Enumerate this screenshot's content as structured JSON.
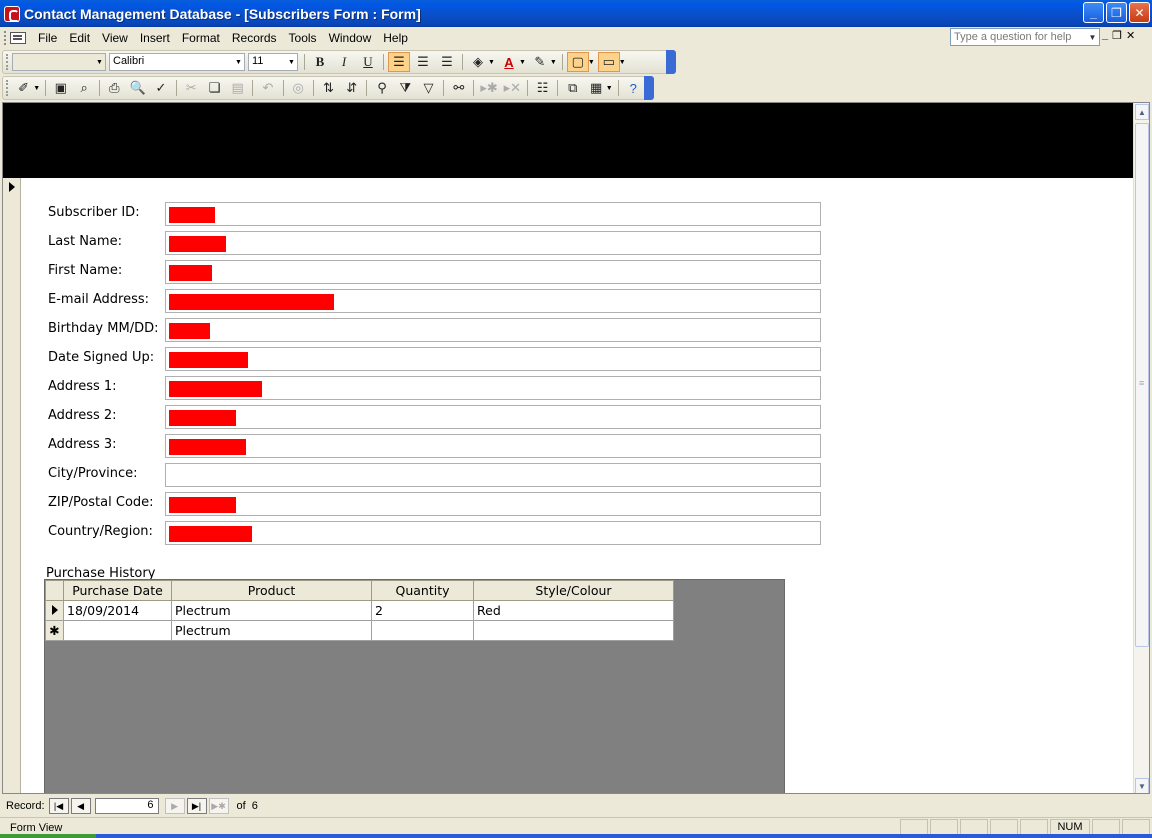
{
  "window": {
    "title": "Contact Management Database - [Subscribers Form : Form]",
    "minimize": "_",
    "restore": "❐",
    "close": "✕"
  },
  "menu": {
    "items": [
      "File",
      "Edit",
      "View",
      "Insert",
      "Format",
      "Records",
      "Tools",
      "Window",
      "Help"
    ],
    "help_placeholder": "Type a question for help",
    "mdi_min": "_",
    "mdi_restore": "❐",
    "mdi_close": "✕"
  },
  "toolbar": {
    "object_combo": "",
    "font_name": "Calibri",
    "font_size": "11",
    "bold": "B",
    "italic": "I",
    "underline": "U"
  },
  "form": {
    "fields": [
      {
        "label": "Subscriber ID:",
        "value": "",
        "redacted": true
      },
      {
        "label": "Last Name:",
        "value": "",
        "redacted": true
      },
      {
        "label": "First Name:",
        "value": "",
        "redacted": true
      },
      {
        "label": "E-mail Address:",
        "value": "",
        "redacted": true
      },
      {
        "label": "Birthday MM/DD:",
        "value": "",
        "redacted": true
      },
      {
        "label": "Date Signed Up:",
        "value": "",
        "redacted": true
      },
      {
        "label": "Address 1:",
        "value": "",
        "redacted": true
      },
      {
        "label": "Address 2:",
        "value": "",
        "redacted": true
      },
      {
        "label": "Address 3:",
        "value": "",
        "redacted": true
      },
      {
        "label": "City/Province:",
        "value": "",
        "redacted": false
      },
      {
        "label": "ZIP/Postal Code:",
        "value": "",
        "redacted": true
      },
      {
        "label": "Country/Region:",
        "value": "",
        "redacted": true
      }
    ],
    "subform_label": "Purchase History",
    "columns": [
      "Purchase Date",
      "Product",
      "Quantity",
      "Style/Colour"
    ],
    "rows": [
      {
        "selector": "current",
        "cells": [
          "18/09/2014",
          "Plectrum",
          "2",
          "Red"
        ]
      },
      {
        "selector": "new",
        "cells": [
          "",
          "Plectrum",
          "",
          ""
        ]
      }
    ],
    "new_row_marker": "✱"
  },
  "navigation": {
    "label": "Record:",
    "current": "6",
    "of": "of",
    "total": "6"
  },
  "status": {
    "text": "Form View",
    "num": "NUM"
  },
  "colors": {
    "redaction": "#ff0000",
    "title_bar": "#0058e6",
    "header_band": "#000000",
    "subform_bg": "#808080"
  }
}
